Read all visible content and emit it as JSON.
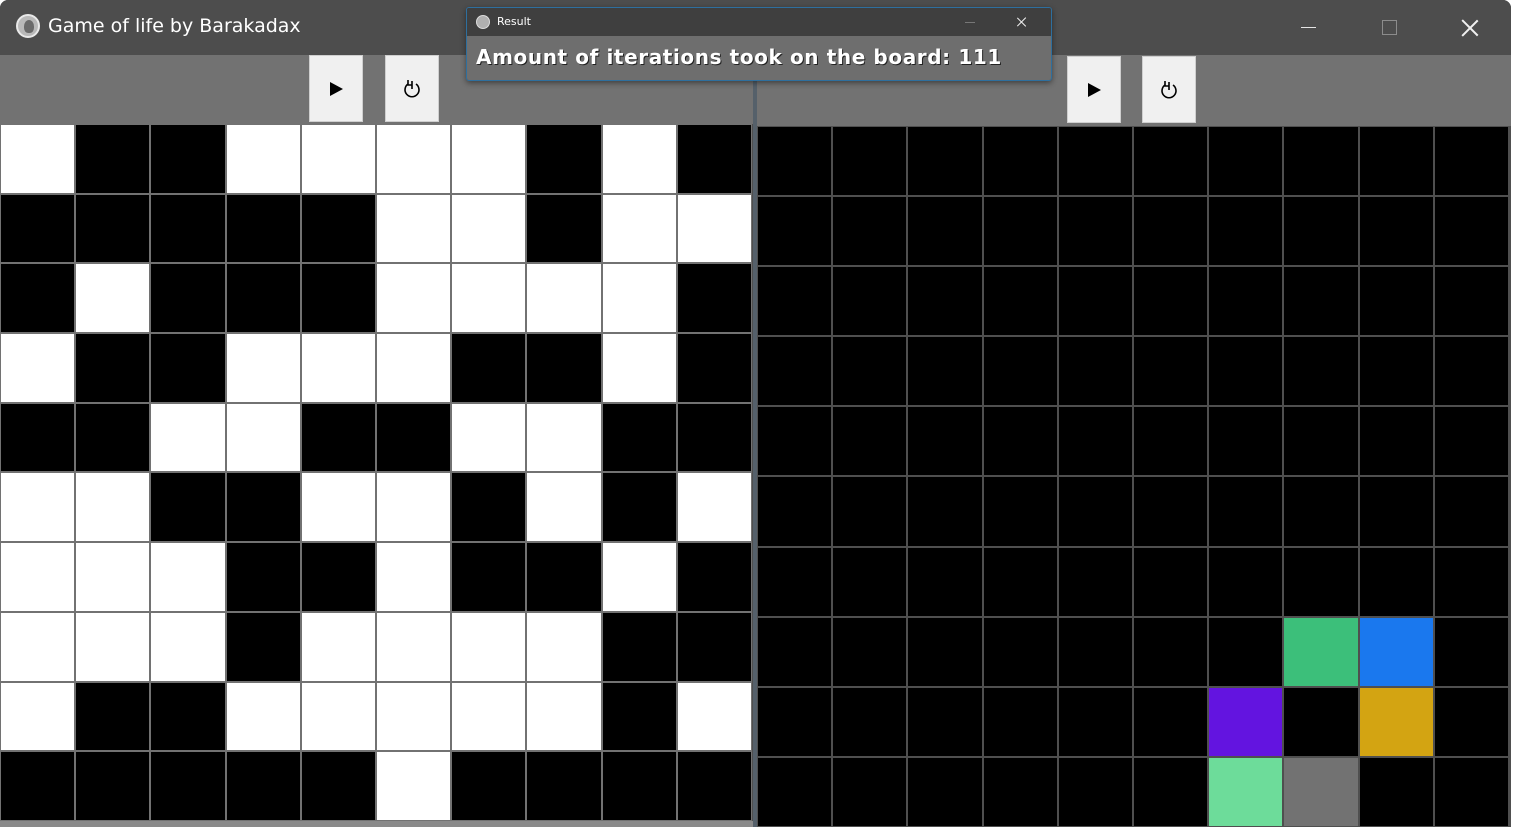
{
  "window": {
    "title": "Game of life by Barakadax",
    "icon": "app-logo-icon",
    "controls": [
      "minimize-icon",
      "maximize-icon",
      "close-icon"
    ]
  },
  "left_panel": {
    "toolbar": {
      "play_icon": "play-icon",
      "reset_icon": "reset-icon"
    },
    "board": {
      "rows": 10,
      "cols": 10,
      "cells": [
        [
          1,
          0,
          0,
          1,
          1,
          1,
          1,
          0,
          1,
          0
        ],
        [
          0,
          0,
          0,
          0,
          0,
          1,
          1,
          0,
          1,
          1
        ],
        [
          0,
          1,
          0,
          0,
          0,
          1,
          1,
          1,
          1,
          0
        ],
        [
          1,
          0,
          0,
          1,
          1,
          1,
          0,
          0,
          1,
          0
        ],
        [
          0,
          0,
          1,
          1,
          0,
          0,
          1,
          1,
          0,
          0
        ],
        [
          1,
          1,
          0,
          0,
          1,
          1,
          0,
          1,
          0,
          1
        ],
        [
          1,
          1,
          1,
          0,
          0,
          1,
          0,
          0,
          1,
          0
        ],
        [
          1,
          1,
          1,
          0,
          1,
          1,
          1,
          1,
          0,
          0
        ],
        [
          1,
          0,
          0,
          1,
          1,
          1,
          1,
          1,
          0,
          1
        ],
        [
          0,
          0,
          0,
          0,
          0,
          1,
          0,
          0,
          0,
          0
        ]
      ],
      "colors": {
        "alive": "#ffffff",
        "dead": "#000000"
      }
    }
  },
  "right_panel": {
    "toolbar": {
      "play_icon": "play-icon",
      "reset_icon": "reset-icon"
    },
    "board": {
      "rows": 10,
      "cols": 10,
      "colored_cells": [
        {
          "row": 7,
          "col": 7,
          "color": "#3cbf7a"
        },
        {
          "row": 7,
          "col": 8,
          "color": "#1a78ee"
        },
        {
          "row": 8,
          "col": 6,
          "color": "#6314e0"
        },
        {
          "row": 8,
          "col": 8,
          "color": "#d3a412"
        },
        {
          "row": 9,
          "col": 6,
          "color": "#6ddc9a"
        },
        {
          "row": 9,
          "col": 7,
          "color": "#727272"
        }
      ],
      "colors": {
        "dead": "#000000"
      }
    }
  },
  "result_dialog": {
    "title": "Result",
    "message": "Amount of iterations took on the board: 111",
    "icon": "app-logo-icon",
    "close_icon": "close-icon"
  }
}
